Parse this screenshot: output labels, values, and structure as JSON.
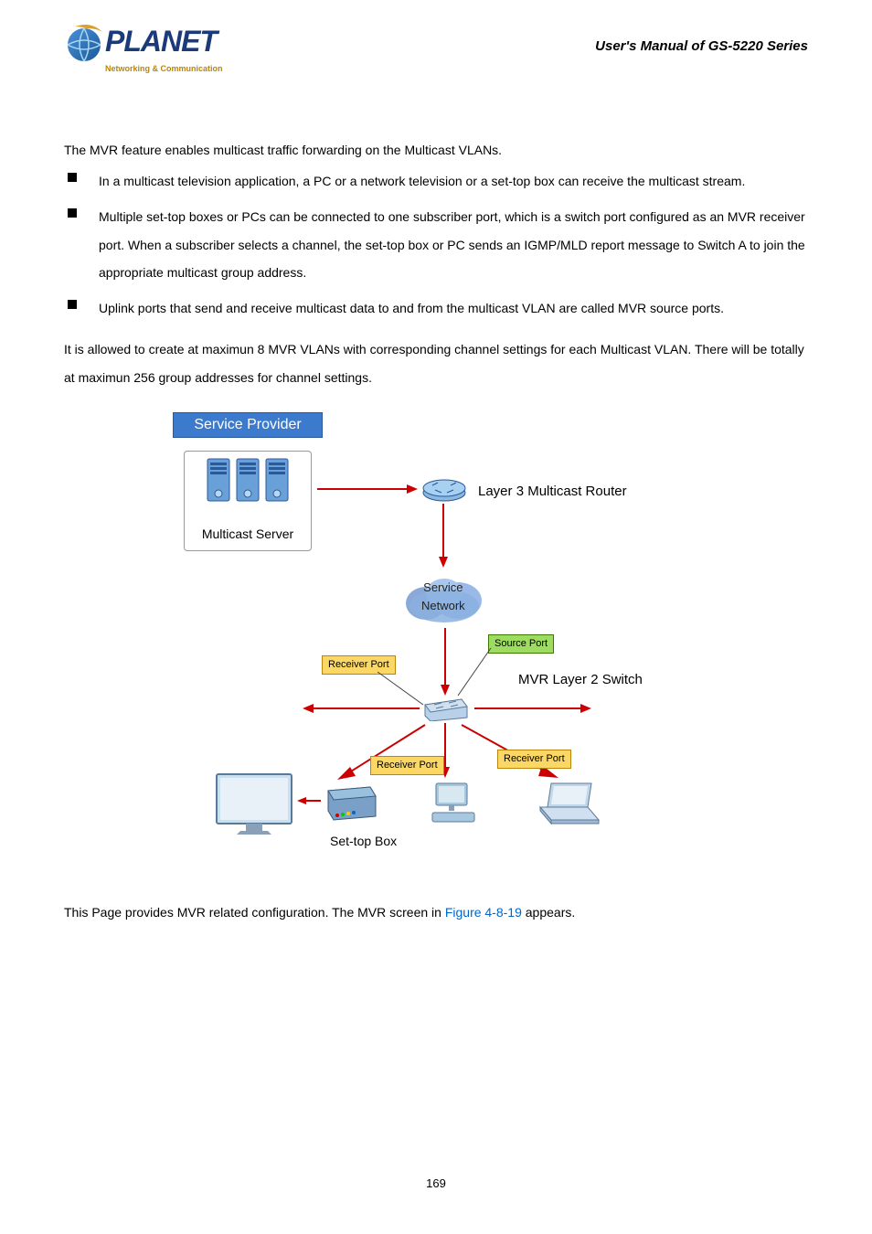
{
  "header": {
    "logo_text": "PLANET",
    "logo_tagline": "Networking & Communication",
    "title": "User's Manual of GS-5220 Series"
  },
  "content": {
    "intro": "The MVR feature enables multicast traffic forwarding on the Multicast VLANs.",
    "bullets": [
      "In a multicast television application, a PC or a network television or a set-top box can receive the multicast stream.",
      "Multiple set-top boxes or PCs can be connected to one subscriber port, which is a switch port configured as an MVR receiver port. When a subscriber selects a channel, the set-top box or PC sends an IGMP/MLD report message to Switch A to join the appropriate multicast group address.",
      "Uplink ports that send and receive multicast data to and from the multicast VLAN are called MVR source ports."
    ],
    "para2": "It is allowed to create at maximun 8 MVR VLANs with corresponding channel settings for each Multicast VLAN. There will be totally at maximun 256 group addresses for channel settings.",
    "bottom_para_1": "This Page provides MVR related configuration. The MVR screen in ",
    "figure_link": "Figure 4-8-19",
    "bottom_para_2": " appears."
  },
  "diagram": {
    "service_provider": "Service Provider",
    "multicast_server": "Multicast Server",
    "l3_router": "Layer 3 Multicast Router",
    "service_network": "Service\nNetwork",
    "source_port": "Source Port",
    "receiver_port": "Receiver Port",
    "mvr_l2_switch": "MVR Layer 2 Switch",
    "settop_box": "Set-top Box"
  },
  "page_number": "169"
}
